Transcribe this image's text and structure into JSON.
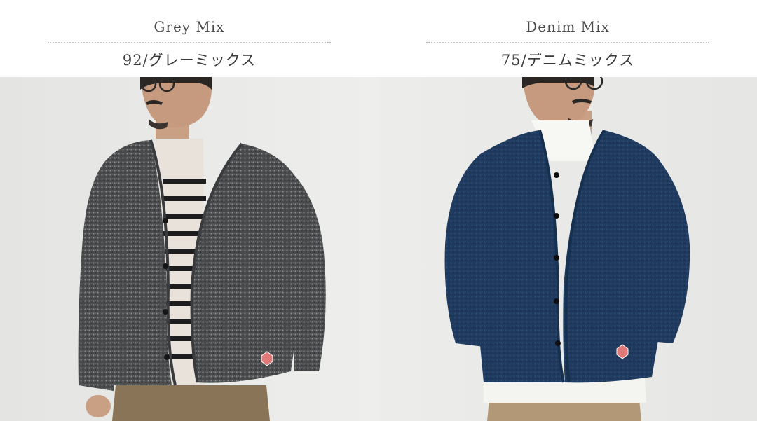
{
  "variants": [
    {
      "name": "Grey Mix",
      "code": "92/グレーミックス"
    },
    {
      "name": "Denim Mix",
      "code": "75/デニムミックス"
    }
  ]
}
